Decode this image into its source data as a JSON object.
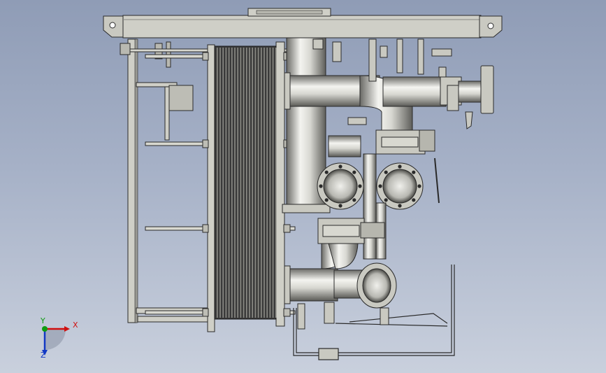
{
  "viewport": {
    "background_top": "#8f9cb6",
    "background_bottom": "#c9d0dd"
  },
  "model": {
    "description_icon": "plate-heat-exchanger-skid-assembly",
    "body_color": "#c9c9c1",
    "edge_color": "#2a2a2a",
    "pipe_light": "#f2f2ee",
    "pipe_dark": "#5c5c58",
    "plate_color": "#2c2c2c"
  },
  "triad": {
    "x_label": "X",
    "y_label": "Y",
    "z_label": "Z",
    "x_color": "#d01010",
    "y_color": "#0e9c10",
    "z_color": "#1238c4"
  }
}
